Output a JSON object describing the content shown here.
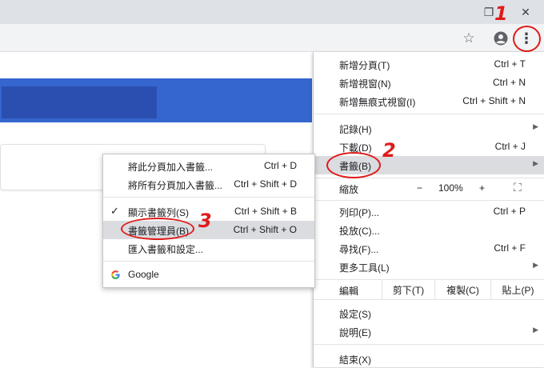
{
  "window_controls": {
    "restore_glyph": "❐",
    "close_glyph": "✕"
  },
  "toolbar": {
    "star_glyph": "☆",
    "account_glyph": "●",
    "menu_glyph": "⋮"
  },
  "main_menu": {
    "new_tab": {
      "label": "新增分頁(T)",
      "shortcut": "Ctrl + T"
    },
    "new_window": {
      "label": "新增視窗(N)",
      "shortcut": "Ctrl + N"
    },
    "new_incognito": {
      "label": "新增無痕式視窗(I)",
      "shortcut": "Ctrl + Shift + N"
    },
    "history": {
      "label": "記錄(H)"
    },
    "downloads": {
      "label": "下載(D)",
      "shortcut": "Ctrl + J"
    },
    "bookmarks": {
      "label": "書籤(B)"
    },
    "zoom": {
      "label": "縮放",
      "minus": "−",
      "value": "100%",
      "plus": "+",
      "fullscreen": "⛶"
    },
    "print": {
      "label": "列印(P)...",
      "shortcut": "Ctrl + P"
    },
    "cast": {
      "label": "投放(C)..."
    },
    "find": {
      "label": "尋找(F)...",
      "shortcut": "Ctrl + F"
    },
    "more_tools": {
      "label": "更多工具(L)"
    },
    "edit": {
      "label": "編輯",
      "cut": "剪下(T)",
      "copy": "複製(C)",
      "paste": "貼上(P)"
    },
    "settings": {
      "label": "設定(S)"
    },
    "help": {
      "label": "說明(E)"
    },
    "exit": {
      "label": "結束(X)"
    },
    "arrow_glyph": "▶"
  },
  "bookmarks_menu": {
    "bookmark_tab": {
      "label": "將此分頁加入書籤...",
      "shortcut": "Ctrl + D"
    },
    "bookmark_all": {
      "label": "將所有分頁加入書籤...",
      "shortcut": "Ctrl + Shift + D"
    },
    "show_bar": {
      "label": "顯示書籤列(S)",
      "shortcut": "Ctrl + Shift + B",
      "check_glyph": "✓"
    },
    "manager": {
      "label": "書籤管理員(B)",
      "shortcut": "Ctrl + Shift + O"
    },
    "import": {
      "label": "匯入書籤和設定..."
    },
    "google": {
      "label": "Google"
    }
  },
  "annotations": {
    "step1": "1",
    "step2": "2",
    "step3": "3"
  },
  "colors": {
    "annotation": "#e01b1b",
    "banner": "#3566cf",
    "highlight": "#dadce0"
  }
}
